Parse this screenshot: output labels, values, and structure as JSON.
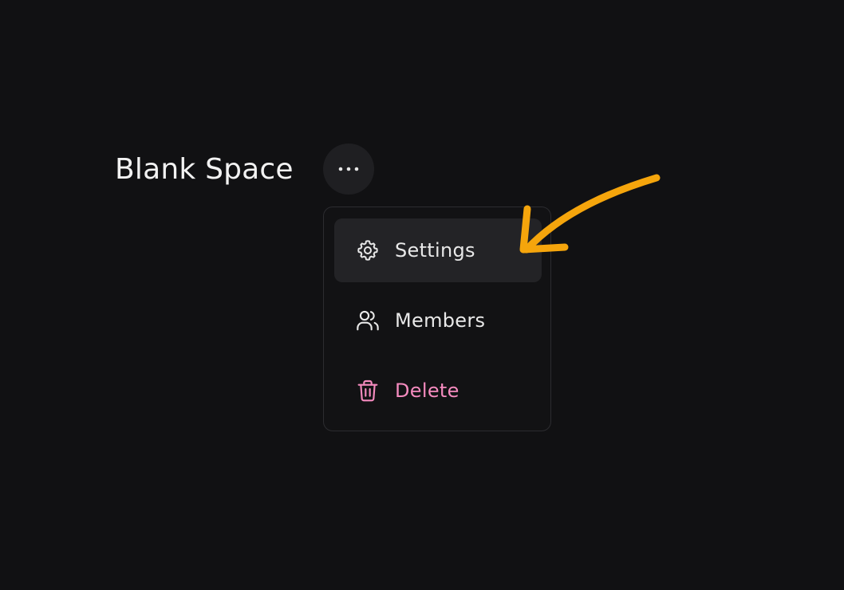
{
  "header": {
    "title": "Blank Space",
    "more_icon": "more-horizontal-icon"
  },
  "menu": {
    "items": [
      {
        "label": "Settings",
        "icon": "gear-icon",
        "state": "hovered"
      },
      {
        "label": "Members",
        "icon": "users-icon"
      },
      {
        "label": "Delete",
        "icon": "trash-icon",
        "color": "#f58bbf"
      }
    ]
  },
  "annotation": {
    "icon": "arrow-annotation-icon",
    "color": "#f5a50c"
  }
}
